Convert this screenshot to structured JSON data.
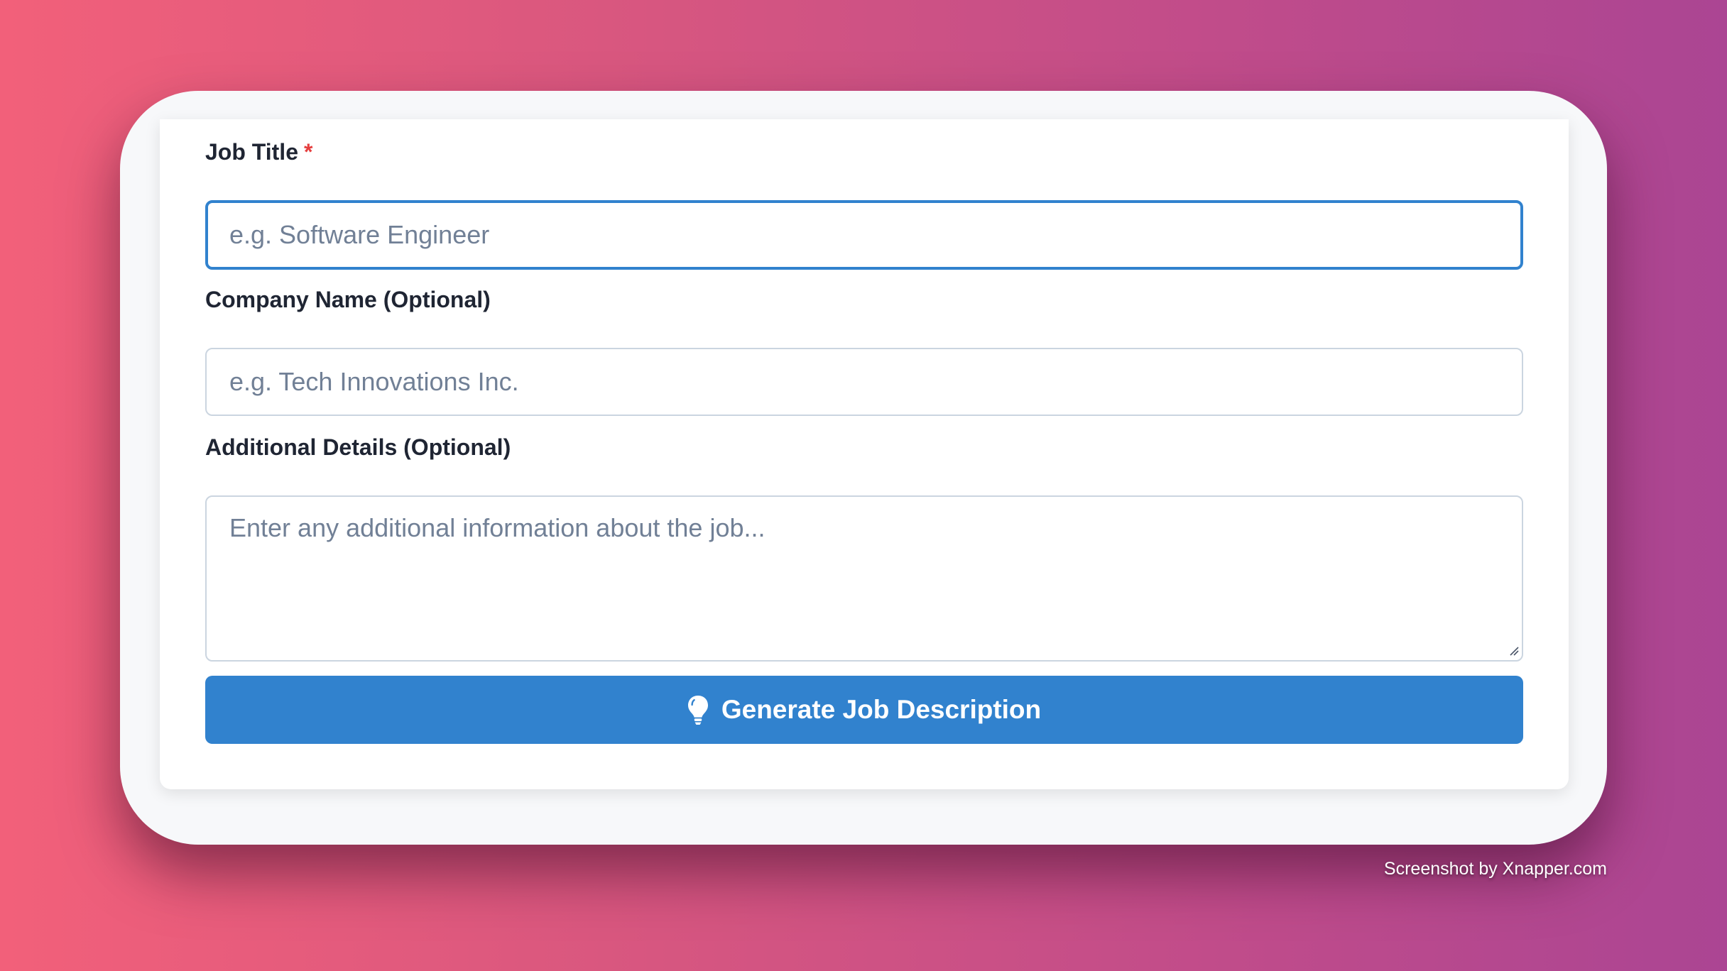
{
  "form": {
    "job_title": {
      "label": "Job Title",
      "required_marker": "*",
      "value": "",
      "placeholder": "e.g. Software Engineer"
    },
    "company_name": {
      "label": "Company Name (Optional)",
      "value": "",
      "placeholder": "e.g. Tech Innovations Inc."
    },
    "additional_details": {
      "label": "Additional Details (Optional)",
      "value": "",
      "placeholder": "Enter any additional information about the job..."
    },
    "submit": {
      "label": "Generate Job Description",
      "icon": "lightbulb-icon"
    }
  },
  "watermark": "Screenshot by Xnapper.com",
  "colors": {
    "primary": "#3182ce",
    "required": "#e53e3e",
    "label_text": "#1f2533",
    "placeholder_text": "#718096",
    "input_border": "#cbd5e0"
  }
}
